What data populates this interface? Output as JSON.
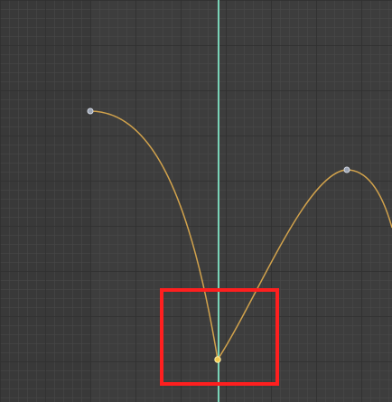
{
  "editor": {
    "type": "graph-editor",
    "background_color": "#3d3d3d",
    "grid_minor_color": "#4a4a4a",
    "grid_major_color": "#2f2f2f",
    "curve_color": "#d1a24c",
    "keyframe_color": "#9aa3b3",
    "selected_keyframe_color": "#f2c94c",
    "playhead_color": "#79d3b7",
    "highlight_box_color": "#ff1f1f"
  }
}
